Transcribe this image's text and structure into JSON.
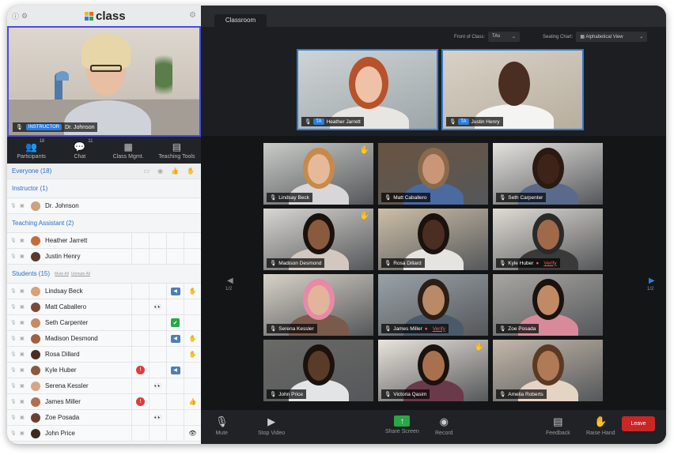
{
  "brand": {
    "name": "class",
    "colors": [
      "#f2b928",
      "#e86a2a",
      "#2a7de1",
      "#29a745"
    ]
  },
  "instructor": {
    "badge": "INSTRUCTOR",
    "name": "Dr. Johnson"
  },
  "left_tabs": [
    {
      "label": "Participants",
      "icon": "participants-icon",
      "count": "18"
    },
    {
      "label": "Chat",
      "icon": "chat-icon",
      "count": "11"
    },
    {
      "label": "Class Mgmt.",
      "icon": "class-management-icon",
      "count": ""
    },
    {
      "label": "Teaching Tools",
      "icon": "teaching-tools-icon",
      "count": ""
    }
  ],
  "participants": {
    "everyone": "Everyone (18)",
    "instructor_header": "Instructor (1)",
    "instructors": [
      "Dr. Johnson"
    ],
    "ta_header": "Teaching Assistant (2)",
    "tas": [
      "Heather Jarrett",
      "Justin Henry"
    ],
    "students_header": "Students (15)",
    "mute_all": "Mute All",
    "unmute_all": "Unmute All",
    "students": [
      "Lindsay Beck",
      "Matt Caballero",
      "Seth Carpenter",
      "Madison Desmond",
      "Rosa Dillard",
      "Kyle Huber",
      "Serena Kessler",
      "James Miller",
      "Zoe Posada",
      "John Price"
    ]
  },
  "classroom_tab": "Classroom",
  "front_of_class": {
    "label": "Front of Class:",
    "value": "TAs"
  },
  "seating_chart": {
    "label": "Seating Chart:",
    "value": "Alphabetical View"
  },
  "tas_front": [
    {
      "badge": "TA",
      "name": "Heather Jarrett"
    },
    {
      "badge": "TA",
      "name": "Justin Henry"
    }
  ],
  "students_grid": [
    {
      "name": "Lindsay Beck",
      "hand": true,
      "alert": ""
    },
    {
      "name": "Matt Caballero",
      "hand": false,
      "alert": ""
    },
    {
      "name": "Seth Carpenter",
      "hand": false,
      "alert": ""
    },
    {
      "name": "Madison Desmond",
      "hand": true,
      "alert": ""
    },
    {
      "name": "Rosa Dillard",
      "hand": false,
      "alert": ""
    },
    {
      "name": "Kyle Huber",
      "hand": false,
      "alert": "Verify"
    },
    {
      "name": "Serena Kessler",
      "hand": false,
      "alert": ""
    },
    {
      "name": "James Miller",
      "hand": false,
      "alert": "Verify"
    },
    {
      "name": "Zoe Posada",
      "hand": false,
      "alert": ""
    },
    {
      "name": "John Price",
      "hand": false,
      "alert": ""
    },
    {
      "name": "Victoria Qasim",
      "hand": true,
      "alert": ""
    },
    {
      "name": "Amelia Roberts",
      "hand": false,
      "alert": ""
    }
  ],
  "page": {
    "left": "1/2",
    "right": "1/2"
  },
  "controls": {
    "mute": "Mute",
    "stop_video": "Stop Video",
    "share_screen": "Share Screen",
    "record": "Record",
    "feedback": "Feedback",
    "raise_hand": "Raise Hand",
    "leave": "Leave"
  }
}
